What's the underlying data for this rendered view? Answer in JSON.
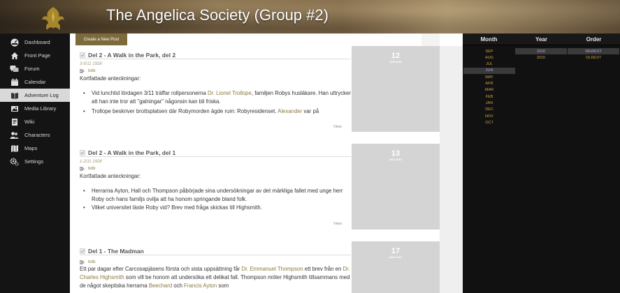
{
  "header": {
    "title": "The Angelica Society (Group #2)"
  },
  "sidebar": {
    "items": [
      {
        "label": "Dashboard",
        "icon": "dashboard-icon"
      },
      {
        "label": "Front Page",
        "icon": "home-icon"
      },
      {
        "label": "Forum",
        "icon": "chat-icon"
      },
      {
        "label": "Calendar",
        "icon": "calendar-icon"
      },
      {
        "label": "Adventure Log",
        "icon": "book-icon"
      },
      {
        "label": "Media Library",
        "icon": "media-icon"
      },
      {
        "label": "Wiki",
        "icon": "wiki-icon"
      },
      {
        "label": "Characters",
        "icon": "characters-icon"
      },
      {
        "label": "Maps",
        "icon": "maps-icon"
      },
      {
        "label": "Settings",
        "icon": "settings-icon"
      }
    ]
  },
  "toolbar": {
    "new_post_label": "Create a New Post"
  },
  "posts": [
    {
      "title": "Del 2 - A Walk in the Park, del 2",
      "date": "3-5/11 1928",
      "tag": "totk",
      "intro": "Kortfattade anteckningar:",
      "bullet1_a": "Vid lunchtid lördagen 3/11 träffar rollpersonerna ",
      "bullet1_link": "Dr. Lionel Trollope",
      "bullet1_b": ", familjen Robys husläkare. Han uttrycker att han inte tror att \"galningar\" någonsin kan bli friska.",
      "bullet2_a": "Trollope beskriver brottsplatsen där Robymorden ägde rum: Robyresidenset. ",
      "bullet2_link": "Alexander",
      "bullet2_b": " var på",
      "view": "View",
      "day": "12",
      "month": "JUNI 2016"
    },
    {
      "title": "Del 2 - A Walk in the Park, del 1",
      "date": "1-2/11 1928",
      "tag": "totk",
      "intro": "Kortfattade anteckningar:",
      "bullet1_a": "Herrarna Ayton, Hall och Thompson påbörjade sina undersökningar av det märkliga fallet med unge herr Roby och hans familjs ovilja att ha honom springande bland folk.",
      "bullet2_a": "Vilket universitet läste Roby vid? Brev med fråga skickas till Highsmith.",
      "view": "View",
      "day": "13",
      "month": "MAJ 2016"
    },
    {
      "title": "Del 1 - The Madman",
      "tag": "totk",
      "p1_a": "Ett par dagar efter Carcosapjäsens första och sista uppsättning får ",
      "p1_link1": "Dr. Emmanuel Thompson",
      "p1_b": " ett brev från en ",
      "p1_link2": "Dr. Charles Highsmith",
      "p1_c": " som vill be honom att undersöka ett delikat fall. Thompson möter Highsmith tillsammans med de något skeptiska herrarna ",
      "p1_link3": "Beechard",
      "p1_d": " och ",
      "p1_link4": "Francis Ayton",
      "p1_e": " som",
      "day": "17",
      "month": "MAJ 2016"
    }
  ],
  "archive": {
    "headers": {
      "month": "Month",
      "year": "Year",
      "order": "Order"
    },
    "months": [
      "SEP",
      "AUG",
      "JUL",
      "JUN",
      "MAY",
      "APR",
      "MAR",
      "FEB",
      "JAN",
      "DEC",
      "NOV",
      "OCT"
    ],
    "selected_month": "JUN",
    "years": [
      "2016",
      "2015"
    ],
    "selected_year": "2016",
    "orders": [
      "NEWEST",
      "OLDEST"
    ],
    "selected_order": "NEWEST"
  },
  "colors": {
    "accent": "#8b7a3e",
    "button": "#7d6b3c",
    "archive_link": "#c8a247",
    "archive_selected": "#a6a8e0"
  }
}
